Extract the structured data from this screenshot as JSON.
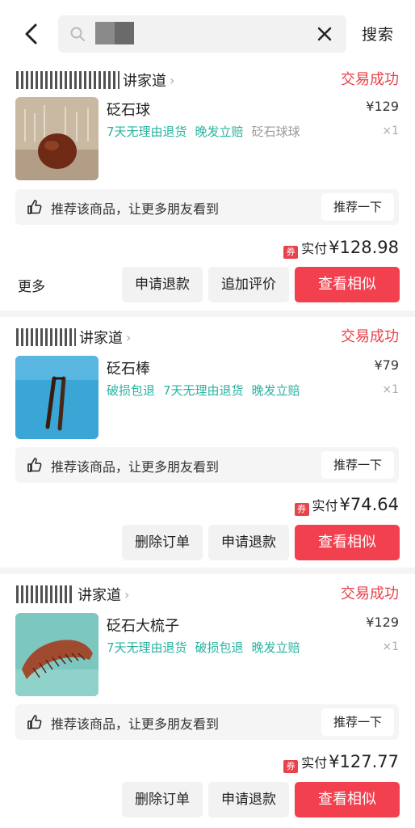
{
  "header": {
    "search_button": "搜索"
  },
  "orders": [
    {
      "shop": "讲家道",
      "status": "交易成功",
      "product": {
        "name": "砭石球",
        "tags": [
          "7天无理由退货",
          "晚发立赔"
        ],
        "variant": "砭石球球",
        "price": "¥129",
        "qty": "×1"
      },
      "recommend": {
        "text": "推荐该商品，让更多朋友看到",
        "button": "推荐一下"
      },
      "paid": {
        "coupon": "券",
        "label": "实付",
        "amount": "¥128.98"
      },
      "actions": {
        "more": "更多",
        "buttons": [
          "申请退款",
          "追加评价"
        ],
        "primary": "查看相似"
      }
    },
    {
      "shop": "讲家道",
      "status": "交易成功",
      "product": {
        "name": "砭石棒",
        "tags": [
          "破损包退",
          "7天无理由退货",
          "晚发立赔"
        ],
        "variant": "",
        "price": "¥79",
        "qty": "×1"
      },
      "recommend": {
        "text": "推荐该商品，让更多朋友看到",
        "button": "推荐一下"
      },
      "paid": {
        "coupon": "券",
        "label": "实付",
        "amount": "¥74.64"
      },
      "actions": {
        "more": "",
        "buttons": [
          "删除订单",
          "申请退款"
        ],
        "primary": "查看相似"
      }
    },
    {
      "shop": "讲家道",
      "status": "交易成功",
      "product": {
        "name": "砭石大梳子",
        "tags": [
          "7天无理由退货",
          "破损包退",
          "晚发立赔"
        ],
        "variant": "",
        "price": "¥129",
        "qty": "×1"
      },
      "recommend": {
        "text": "推荐该商品，让更多朋友看到",
        "button": "推荐一下"
      },
      "paid": {
        "coupon": "券",
        "label": "实付",
        "amount": "¥127.77"
      },
      "actions": {
        "more": "",
        "buttons": [
          "删除订单",
          "申请退款"
        ],
        "primary": "查看相似"
      }
    }
  ],
  "colors": {
    "accent_red": "#e8424a",
    "tag_teal": "#27b3a0",
    "primary_button": "#f2404f"
  },
  "icons": {
    "back": "chevron-left-icon",
    "search": "search-icon",
    "clear": "close-icon",
    "like": "thumbs-up-icon"
  }
}
